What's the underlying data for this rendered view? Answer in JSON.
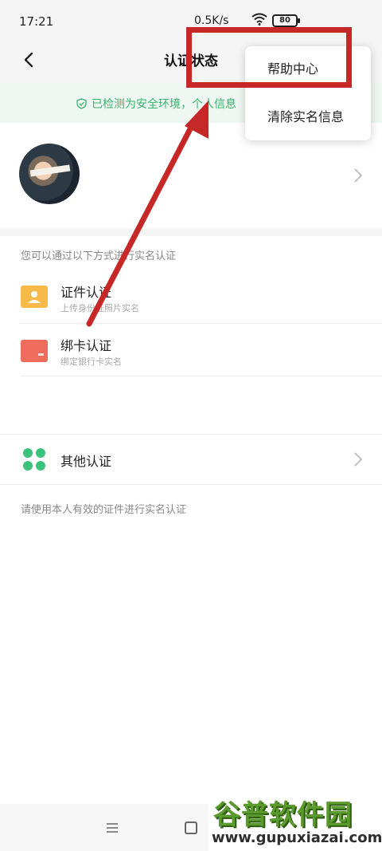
{
  "status_bar": {
    "time": "17:21",
    "network_speed": "0.5K/s",
    "battery": "80"
  },
  "nav": {
    "title": "认证状态"
  },
  "notice": {
    "text": "已检测为安全环境，个人信息"
  },
  "menu": {
    "items": [
      "帮助中心",
      "清除实名信息"
    ]
  },
  "methods": {
    "hint": "您可以通过以下方式进行实名认证",
    "items": [
      {
        "title": "证件认证",
        "subtitle": "上传身份证照片实名",
        "color": "#f7b94a"
      },
      {
        "title": "绑卡认证",
        "subtitle": "绑定银行卡实名",
        "color": "#ef6b5b"
      }
    ]
  },
  "other": {
    "title": "其他认证",
    "color": "#3cc27a"
  },
  "footer": {
    "hint": "请使用本人有效的证件进行实名认证"
  },
  "watermark": {
    "logo": "谷普软件园",
    "url": "www.gupuxiazai.com"
  },
  "colors": {
    "accent_green": "#36b36a",
    "annotation_red": "#c62828"
  }
}
